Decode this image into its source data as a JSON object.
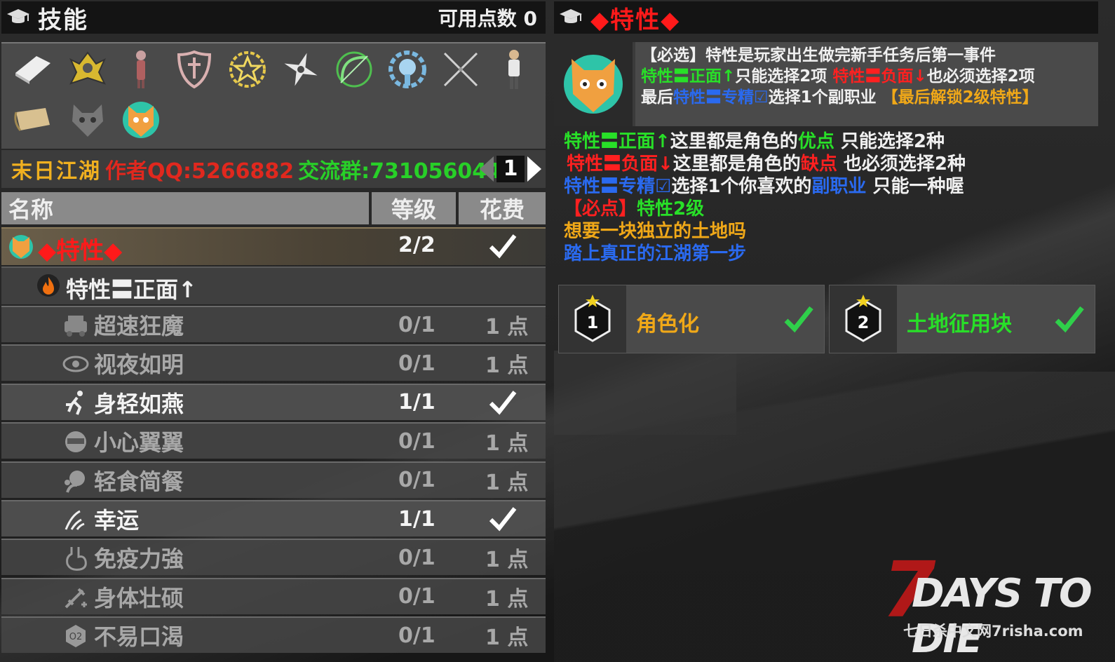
{
  "left_panel": {
    "title": "技能",
    "points": "可用点数 0",
    "icons": [
      "book-icon",
      "armor-icon",
      "character-icon",
      "sword-shield-icon",
      "star-badge-icon",
      "shuriken-icon",
      "bow-icon",
      "gear-skull-icon",
      "crossed-swords-icon",
      "survivor-icon",
      "scroll-icon",
      "cat-icon",
      "tiger-icon"
    ],
    "banner": {
      "part1": "末日江湖",
      "part2": "作者QQ:5266882",
      "part3": "交流群:731056044"
    },
    "page": "1",
    "columns": {
      "name": "名称",
      "level": "等级",
      "cost": "花费"
    },
    "trait_row": {
      "name": "◆特性◆",
      "level": "2/2"
    },
    "category_row": {
      "name": "特性〓正面↑"
    },
    "skills": [
      {
        "name": "超速狂魔",
        "level": "0/1",
        "cost": "1 点",
        "unlocked": false,
        "icon": "car-icon"
      },
      {
        "name": "视夜如明",
        "level": "0/1",
        "cost": "1 点",
        "unlocked": false,
        "icon": "eye-icon"
      },
      {
        "name": "身轻如燕",
        "level": "1/1",
        "cost": "",
        "unlocked": true,
        "icon": "runner-icon"
      },
      {
        "name": "小心翼翼",
        "level": "0/1",
        "cost": "1 点",
        "unlocked": false,
        "icon": "ninja-icon"
      },
      {
        "name": "轻食简餐",
        "level": "0/1",
        "cost": "1 点",
        "unlocked": false,
        "icon": "head-eat-icon"
      },
      {
        "name": "幸运",
        "level": "1/1",
        "cost": "",
        "unlocked": true,
        "icon": "lucky-icon"
      },
      {
        "name": "免疫力強",
        "level": "0/1",
        "cost": "1 点",
        "unlocked": false,
        "icon": "stomach-icon"
      },
      {
        "name": "身体壮硕",
        "level": "0/1",
        "cost": "1 点",
        "unlocked": false,
        "icon": "syringe-icon"
      },
      {
        "name": "不易口渴",
        "level": "0/1",
        "cost": "1 点",
        "unlocked": false,
        "icon": "o2-icon"
      }
    ]
  },
  "right_panel": {
    "title": "◆特性◆",
    "desc": {
      "l1": "【必选】特性是玩家出生做完新手任务后第一事件",
      "l2a": "特性〓正面↑",
      "l2b": "只能选择2项",
      "l2c": "特性〓负面↓",
      "l2d": "也必须选择2项",
      "l3a": "最后",
      "l3b": "特性〓专精☑",
      "l3c": "选择1个副职业",
      "l3d": "【最后解锁2级特性】"
    },
    "lines": {
      "a1": "特性〓正面↑",
      "a2": "这里都是角色的",
      "a3": "优点",
      "a4": " 只能选择2种",
      "b1": "特性〓负面↓",
      "b2": "这里都是角色的",
      "b3": "缺点",
      "b4": " 也必须选择2种",
      "c1": "特性〓专精☑",
      "c2": "选择1个你喜欢的",
      "c3": "副职业",
      "c4": " 只能一种喔",
      "d1": "【必点】",
      "d2": "特性2级",
      "e1": "想要一块独立的土地吗",
      "f1": "踏上真正的江湖第一步"
    },
    "choices": [
      {
        "num": "1",
        "label": "角色化",
        "color": "#f0a818"
      },
      {
        "num": "2",
        "label": "土地征用块",
        "color": "#28e028"
      }
    ]
  },
  "logo": {
    "seven": "7",
    "days": "DAYS TO DIE",
    "sub": "七日杀中文网7risha.com"
  }
}
